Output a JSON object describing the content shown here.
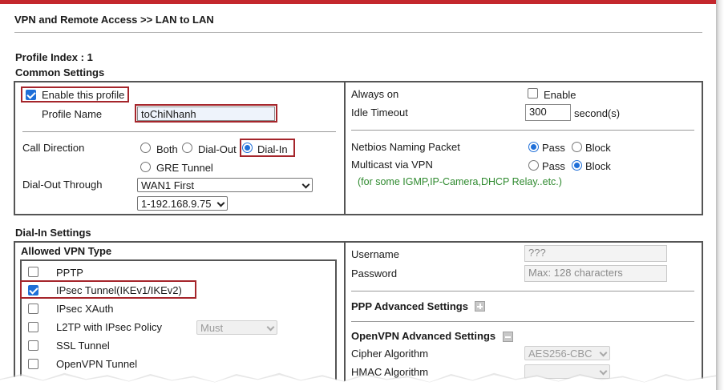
{
  "header": {
    "title": "VPN and Remote Access >> LAN to LAN"
  },
  "profile_index": "Profile Index : 1",
  "common": {
    "title": "Common Settings",
    "enable_label": "Enable this profile",
    "enable_checked": true,
    "profile_name_label": "Profile Name",
    "profile_name_value": "toChiNhanh",
    "call_direction_label": "Call Direction",
    "call_direction_options": [
      "Both",
      "Dial-Out",
      "Dial-In",
      "GRE Tunnel"
    ],
    "call_direction_selected": "Dial-In",
    "dial_out_through_label": "Dial-Out Through",
    "dial_out_through_value": "WAN1 First",
    "dial_out_ip_value": "1-192.168.9.75",
    "always_on_label": "Always on",
    "always_on_enable_label": "Enable",
    "idle_timeout_label": "Idle Timeout",
    "idle_timeout_value": "300",
    "idle_timeout_unit": "second(s)",
    "netbios_label": "Netbios Naming Packet",
    "pass_label": "Pass",
    "block_label": "Block",
    "netbios_selected": "Pass",
    "multicast_label": "Multicast via VPN",
    "multicast_selected": "Block",
    "multicast_note": "(for some IGMP,IP-Camera,DHCP Relay..etc.)"
  },
  "dialin": {
    "title": "Dial-In Settings",
    "allowed_vpn_title": "Allowed VPN Type",
    "vpn_types": [
      {
        "label": "PPTP",
        "checked": false
      },
      {
        "label": "IPsec Tunnel(IKEv1/IKEv2)",
        "checked": true
      },
      {
        "label": "IPsec XAuth",
        "checked": false
      },
      {
        "label": "L2TP with IPsec Policy",
        "checked": false
      },
      {
        "label": "SSL Tunnel",
        "checked": false
      },
      {
        "label": "OpenVPN Tunnel",
        "checked": false
      }
    ],
    "l2tp_policy_value": "Must",
    "username_label": "Username",
    "username_placeholder": "???",
    "password_label": "Password",
    "password_placeholder": "Max: 128 characters",
    "ppp_advanced_label": "PPP Advanced Settings",
    "openvpn_advanced_label": "OpenVPN Advanced Settings",
    "cipher_label": "Cipher Algorithm",
    "cipher_value": "AES256-CBC",
    "hmac_label": "HMAC Algorithm"
  },
  "colors": {
    "accent_red": "#c4272d",
    "highlight": "#a5252b",
    "radio_blue": "#1f6fd8",
    "note_green": "#2f8a2f"
  },
  "icons": [
    "plus-icon",
    "minus-icon",
    "chevron-down-icon"
  ]
}
